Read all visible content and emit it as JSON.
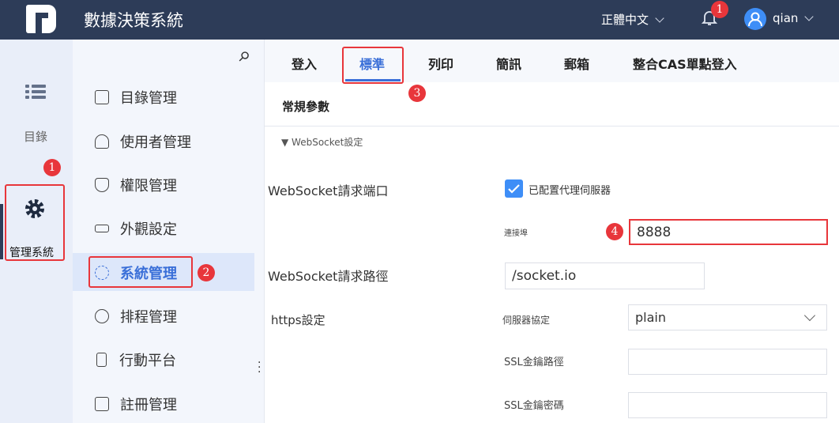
{
  "header": {
    "title": "數據決策系統",
    "language": "正體中文",
    "notification_count": "1",
    "username": "qian"
  },
  "rail": {
    "items": [
      {
        "label": "目錄"
      },
      {
        "label": "管理系統"
      }
    ]
  },
  "menu": {
    "items": [
      {
        "label": "目錄管理"
      },
      {
        "label": "使用者管理"
      },
      {
        "label": "權限管理"
      },
      {
        "label": "外觀設定"
      },
      {
        "label": "系統管理"
      },
      {
        "label": "排程管理"
      },
      {
        "label": "行動平台"
      },
      {
        "label": "註冊管理"
      }
    ]
  },
  "tabs": [
    {
      "label": "登入"
    },
    {
      "label": "標準"
    },
    {
      "label": "列印"
    },
    {
      "label": "簡訊"
    },
    {
      "label": "郵箱"
    },
    {
      "label": "整合CAS單點登入"
    }
  ],
  "section": {
    "title": "常規參數",
    "group": "▼ WebSocket設定"
  },
  "form": {
    "port_label": "WebSocket請求端口",
    "proxy_checkbox": "已配置代理伺服器",
    "proxy_checked": true,
    "connect_port_label": "連接埠",
    "connect_port_value": "8888",
    "path_label": "WebSocket請求路徑",
    "path_value": "/socket.io",
    "https_label": "https設定",
    "protocol_label": "伺服器協定",
    "protocol_value": "plain",
    "ssl_path_label": "SSL金鑰路徑",
    "ssl_path_value": "",
    "ssl_pwd_label": "SSL金鑰密碼",
    "ssl_pwd_value": ""
  },
  "annotations": [
    "1",
    "2",
    "3",
    "4"
  ],
  "colors": {
    "header": "#2d3c58",
    "accent": "#3a6fd8",
    "annotation": "#e8363b"
  }
}
